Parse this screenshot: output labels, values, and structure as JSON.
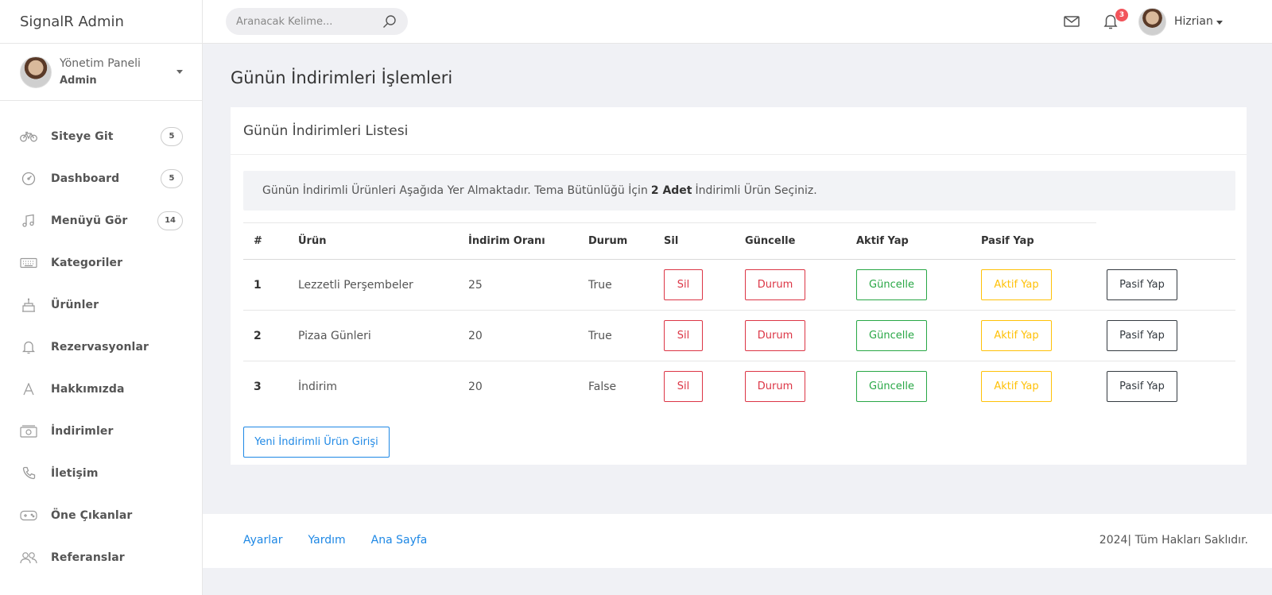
{
  "app": {
    "brand": "SignalR Admin"
  },
  "profile": {
    "name": "Yönetim Paneli",
    "role": "Admin"
  },
  "sidebar": {
    "items": [
      {
        "label": "Siteye Git",
        "badge": "5",
        "icon": "bicycle-icon"
      },
      {
        "label": "Dashboard",
        "badge": "5",
        "icon": "gauge-icon"
      },
      {
        "label": "Menüyü Gör",
        "badge": "14",
        "icon": "music-note-icon"
      },
      {
        "label": "Kategoriler",
        "badge": "",
        "icon": "keyboard-icon"
      },
      {
        "label": "Ürünler",
        "badge": "",
        "icon": "cake-icon"
      },
      {
        "label": "Rezervasyonlar",
        "badge": "",
        "icon": "bell-icon"
      },
      {
        "label": "Hakkımızda",
        "badge": "",
        "icon": "letter-a-icon"
      },
      {
        "label": "İndirimler",
        "badge": "",
        "icon": "money-icon"
      },
      {
        "label": "İletişim",
        "badge": "",
        "icon": "phone-icon"
      },
      {
        "label": "Öne Çıkanlar",
        "badge": "",
        "icon": "gamepad-icon"
      },
      {
        "label": "Referanslar",
        "badge": "",
        "icon": "users-icon"
      }
    ]
  },
  "header": {
    "search_placeholder": "Aranacak Kelime...",
    "notification_count": "3",
    "user_name": "Hizrian"
  },
  "main": {
    "page_title": "Günün İndirimleri İşlemleri",
    "card_title": "Günün İndirimleri Listesi",
    "alert": {
      "before": "Günün İndirimli Ürünleri Aşağıda Yer Almaktadır. Tema Bütünlüğü İçin",
      "bold": "2 Adet",
      "after": "İndirimli Ürün Seçiniz."
    },
    "table": {
      "headers": [
        "#",
        "Ürün",
        "İndirim Oranı",
        "Durum",
        "Sil",
        "Güncelle",
        "Aktif Yap",
        "Pasif Yap"
      ],
      "rows": [
        {
          "num": "1",
          "product": "Lezzetli Perşembeler",
          "rate": "25",
          "status": "True"
        },
        {
          "num": "2",
          "product": "Pizaa Günleri",
          "rate": "20",
          "status": "True"
        },
        {
          "num": "3",
          "product": "İndirim",
          "rate": "20",
          "status": "False"
        }
      ],
      "buttons": {
        "delete": "Sil",
        "status": "Durum",
        "update": "Güncelle",
        "activate": "Aktif Yap",
        "deactivate": "Pasif Yap"
      }
    },
    "new_button": "Yeni İndirimli Ürün Girişi"
  },
  "footer": {
    "links": [
      "Ayarlar",
      "Yardım",
      "Ana Sayfa"
    ],
    "copyright": "2024| Tüm Hakları Saklıdır."
  },
  "colors": {
    "danger": "#dc3545",
    "success": "#28a745",
    "warning": "#ffc107",
    "dark": "#343a40",
    "link": "#1e88e5",
    "badge": "#f2545b"
  }
}
